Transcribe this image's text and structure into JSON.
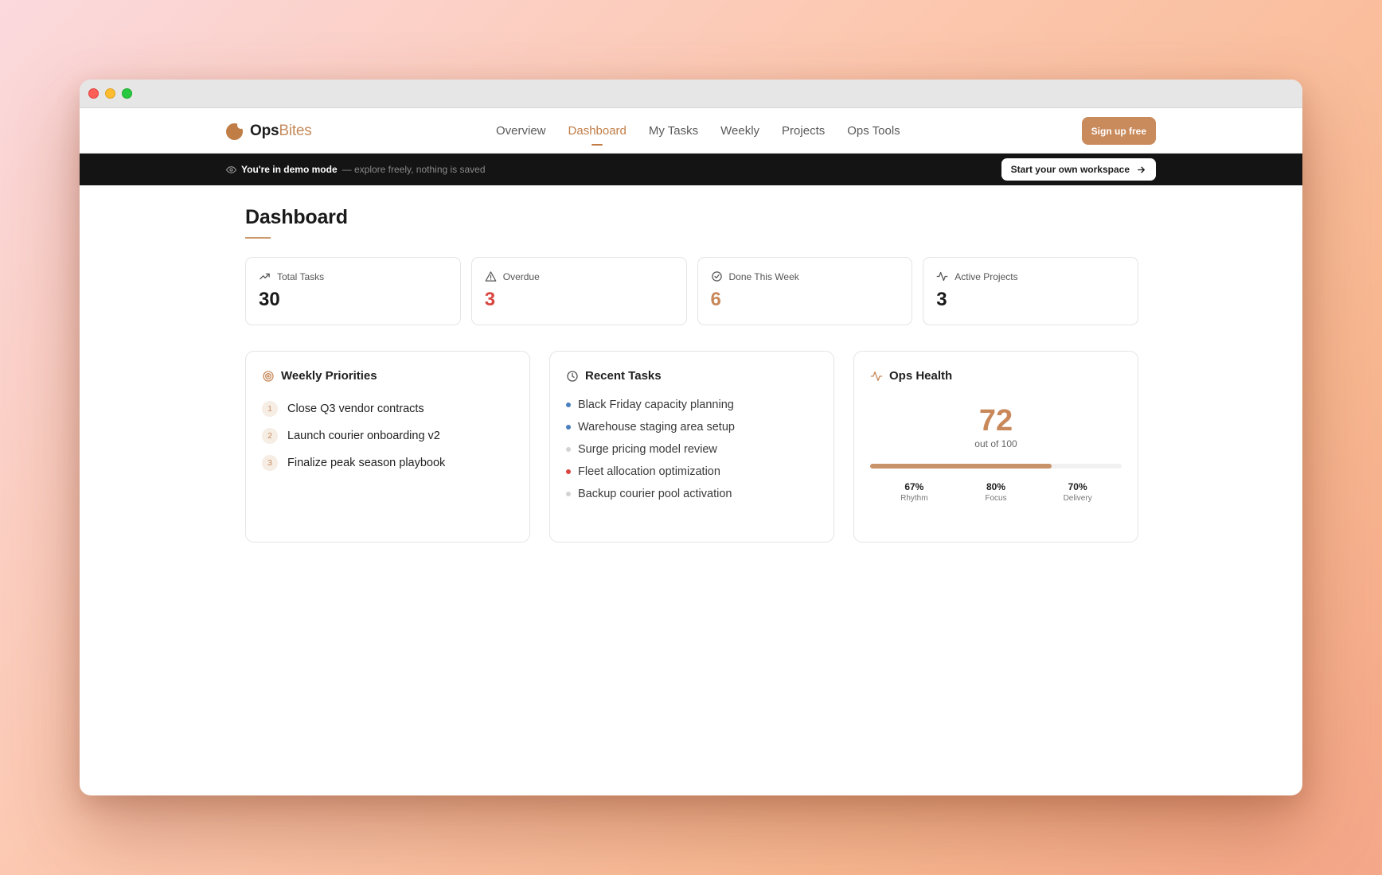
{
  "brand": {
    "name_bold": "Ops",
    "name_light": "Bites"
  },
  "nav": {
    "links": [
      {
        "label": "Overview",
        "active": false
      },
      {
        "label": "Dashboard",
        "active": true
      },
      {
        "label": "My Tasks",
        "active": false
      },
      {
        "label": "Weekly",
        "active": false
      },
      {
        "label": "Projects",
        "active": false
      },
      {
        "label": "Ops Tools",
        "active": false
      }
    ],
    "signup_label": "Sign up free"
  },
  "demo": {
    "strong": "You're in demo mode",
    "muted": "— explore freely, nothing is saved",
    "workspace_label": "Start your own workspace",
    "icon": "eye-icon"
  },
  "page": {
    "title": "Dashboard"
  },
  "stats": [
    {
      "label": "Total Tasks",
      "value": "30",
      "icon": "trending-up-icon"
    },
    {
      "label": "Overdue",
      "value": "3",
      "icon": "alert-triangle-icon"
    },
    {
      "label": "Done This Week",
      "value": "6",
      "icon": "check-circle-icon"
    },
    {
      "label": "Active Projects",
      "value": "3",
      "icon": "activity-icon"
    }
  ],
  "priorities": {
    "title": "Weekly Priorities",
    "icon": "target-icon",
    "items": [
      {
        "num": "1",
        "text": "Close Q3 vendor contracts"
      },
      {
        "num": "2",
        "text": "Launch courier onboarding v2"
      },
      {
        "num": "3",
        "text": "Finalize peak season playbook"
      }
    ]
  },
  "recent": {
    "title": "Recent Tasks",
    "icon": "clock-icon",
    "items": [
      {
        "text": "Black Friday capacity planning",
        "status_color": "#4a7fc1"
      },
      {
        "text": "Warehouse staging area setup",
        "status_color": "#4a7fc1"
      },
      {
        "text": "Surge pricing model review",
        "status_color": "#d3d3d3"
      },
      {
        "text": "Fleet allocation optimization",
        "status_color": "#d94640"
      },
      {
        "text": "Backup courier pool activation",
        "status_color": "#d3d3d3"
      }
    ]
  },
  "health": {
    "title": "Ops Health",
    "icon": "activity-icon",
    "score": "72",
    "score_sub": "out of 100",
    "progress": 0.72,
    "metrics": [
      {
        "value": "67%",
        "label": "Rhythm"
      },
      {
        "value": "80%",
        "label": "Focus"
      },
      {
        "value": "70%",
        "label": "Delivery"
      }
    ]
  },
  "colors": {
    "accent": "#c17d46",
    "overdue": "#d94640",
    "done": "#c8885a"
  }
}
